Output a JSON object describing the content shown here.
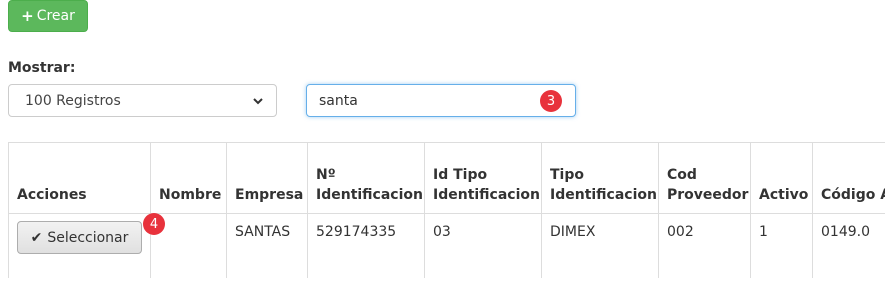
{
  "toolbar": {
    "create_label": "Crear"
  },
  "filter": {
    "show_label": "Mostrar:",
    "show_value": "100 Registros",
    "search_value": "santa"
  },
  "markers": {
    "search": "3",
    "select": "4"
  },
  "table": {
    "headers": {
      "actions": "Acciones",
      "name": "Nombre",
      "company": "Empresa",
      "id_num": "Nº Identificacion",
      "id_type_id": "Id Tipo Identificacion",
      "id_type": "Tipo Identificacion",
      "supplier_code": "Cod Proveedor",
      "active": "Activo",
      "activity_code": "Código Actividad"
    },
    "rows": [
      {
        "action_label": "Seleccionar",
        "name": "",
        "company": "SANTAS",
        "id_num": "529174335",
        "id_type_id": "03",
        "id_type": "DIMEX",
        "supplier_code": "002",
        "active": "1",
        "activity_code": "0149.0"
      }
    ]
  },
  "colors": {
    "create_bg": "#5cb85c",
    "marker": "#e8323c",
    "focus_border": "#66afe9"
  }
}
